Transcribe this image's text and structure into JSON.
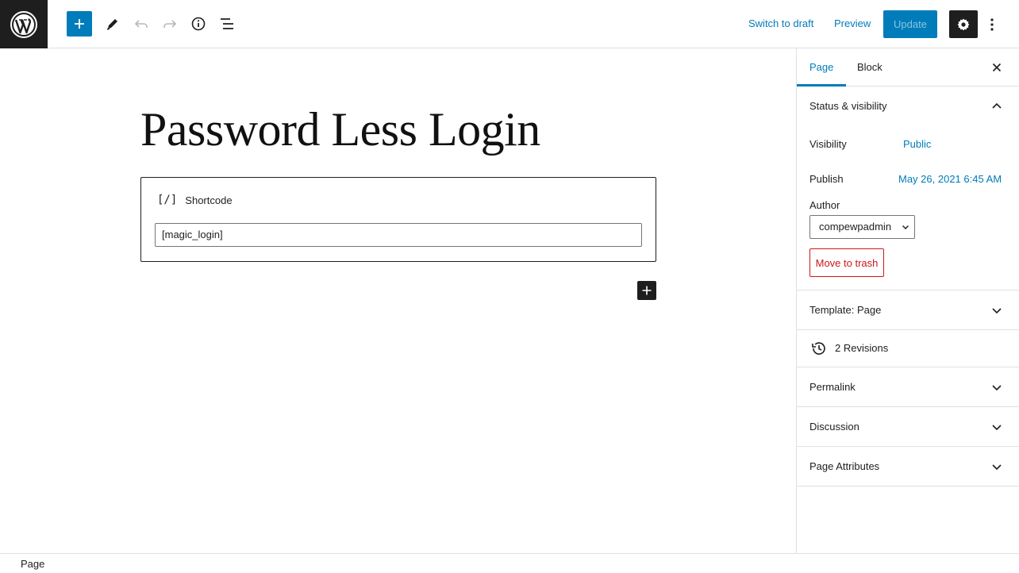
{
  "toolbar": {
    "switch_to_draft": "Switch to draft",
    "preview": "Preview",
    "update": "Update"
  },
  "editor": {
    "title": "Password Less Login",
    "block": {
      "label": "Shortcode",
      "icon_text": "[/]",
      "value": "[magic_login]"
    }
  },
  "sidebar": {
    "tabs": [
      "Page",
      "Block"
    ],
    "status": {
      "title": "Status & visibility",
      "visibility_label": "Visibility",
      "visibility_value": "Public",
      "publish_label": "Publish",
      "publish_value": "May 26, 2021 6:45 AM",
      "author_label": "Author",
      "author_value": "compewpadmin",
      "trash": "Move to trash"
    },
    "template": "Template: Page",
    "revisions": "2 Revisions",
    "permalink": "Permalink",
    "discussion": "Discussion",
    "page_attributes": "Page Attributes"
  },
  "footer": {
    "breadcrumb": "Page"
  },
  "colors": {
    "accent": "#007cba",
    "dark": "#1e1e1e",
    "danger": "#cc1818"
  }
}
